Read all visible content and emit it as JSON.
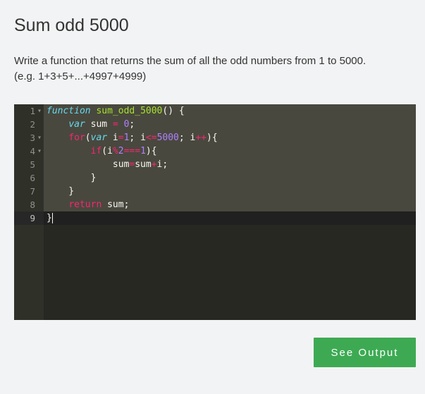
{
  "page": {
    "title": "Sum odd 5000",
    "description_line1": "Write a function that returns the sum of all the odd numbers from 1 to 5000.",
    "description_line2": "(e.g. 1+3+5+...+4997+4999)"
  },
  "editor": {
    "line_numbers": [
      "1",
      "2",
      "3",
      "4",
      "5",
      "6",
      "7",
      "8",
      "9"
    ],
    "fold_marker": "▾",
    "lines": [
      [
        {
          "t": "function",
          "c": "kw-i"
        },
        {
          "t": " ",
          "c": "plain"
        },
        {
          "t": "sum_odd_5000",
          "c": "fn"
        },
        {
          "t": "() {",
          "c": "plain"
        }
      ],
      [
        {
          "t": "    ",
          "c": "plain"
        },
        {
          "t": "var",
          "c": "kw-i"
        },
        {
          "t": " sum ",
          "c": "plain"
        },
        {
          "t": "=",
          "c": "op"
        },
        {
          "t": " ",
          "c": "plain"
        },
        {
          "t": "0",
          "c": "num"
        },
        {
          "t": ";",
          "c": "plain"
        }
      ],
      [
        {
          "t": "    ",
          "c": "plain"
        },
        {
          "t": "for",
          "c": "kw"
        },
        {
          "t": "(",
          "c": "plain"
        },
        {
          "t": "var",
          "c": "kw-i"
        },
        {
          "t": " i",
          "c": "plain"
        },
        {
          "t": "=",
          "c": "op"
        },
        {
          "t": "1",
          "c": "num"
        },
        {
          "t": "; i",
          "c": "plain"
        },
        {
          "t": "<=",
          "c": "op"
        },
        {
          "t": "5000",
          "c": "num"
        },
        {
          "t": "; i",
          "c": "plain"
        },
        {
          "t": "++",
          "c": "op"
        },
        {
          "t": "){",
          "c": "plain"
        }
      ],
      [
        {
          "t": "        ",
          "c": "plain"
        },
        {
          "t": "if",
          "c": "kw"
        },
        {
          "t": "(i",
          "c": "plain"
        },
        {
          "t": "%",
          "c": "op"
        },
        {
          "t": "2",
          "c": "num"
        },
        {
          "t": "===",
          "c": "op"
        },
        {
          "t": "1",
          "c": "num"
        },
        {
          "t": "){",
          "c": "plain"
        }
      ],
      [
        {
          "t": "            sum",
          "c": "plain"
        },
        {
          "t": "=",
          "c": "op"
        },
        {
          "t": "sum",
          "c": "plain"
        },
        {
          "t": "+",
          "c": "op"
        },
        {
          "t": "i;",
          "c": "plain"
        }
      ],
      [
        {
          "t": "        }",
          "c": "plain"
        }
      ],
      [
        {
          "t": "    }",
          "c": "plain"
        }
      ],
      [
        {
          "t": "    ",
          "c": "plain"
        },
        {
          "t": "return",
          "c": "kw"
        },
        {
          "t": " sum;",
          "c": "plain"
        }
      ],
      [
        {
          "t": "}",
          "c": "plain"
        }
      ]
    ],
    "foldable_lines": [
      0,
      2,
      3
    ],
    "active_line": 8
  },
  "actions": {
    "see_output_label": "See Output"
  },
  "colors": {
    "button": "#3daa53",
    "editor_bg": "#272822",
    "selection": "#49483e"
  }
}
